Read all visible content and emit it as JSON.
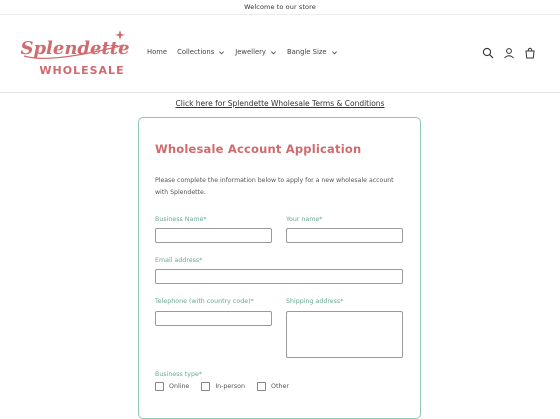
{
  "announcement": "Welcome to our store",
  "logo": {
    "line1": "Splendette",
    "line2": "WHOLESALE"
  },
  "nav": [
    {
      "label": "Home"
    },
    {
      "label": "Collections"
    },
    {
      "label": "Jewellery"
    },
    {
      "label": "Bangle Size"
    }
  ],
  "header_icons": [
    "search-icon",
    "account-icon",
    "cart-icon"
  ],
  "terms_link": "Click here for Splendette Wholesale Terms & Conditions",
  "form": {
    "title": "Wholesale Account Application",
    "intro": "Please complete the information below to apply for a new wholesale account with Splendette.",
    "business_name_label": "Business Name*",
    "your_name_label": "Your name*",
    "email_label": "Email address*",
    "telephone_label": "Telephone (with country code)*",
    "shipping_label": "Shipping address*",
    "business_type_label": "Business type*",
    "business_types": [
      "Online",
      "In-person",
      "Other"
    ]
  },
  "colors": {
    "brand": "#d06a6e",
    "accent": "#6aa895",
    "card_border": "#8fc7b8"
  }
}
